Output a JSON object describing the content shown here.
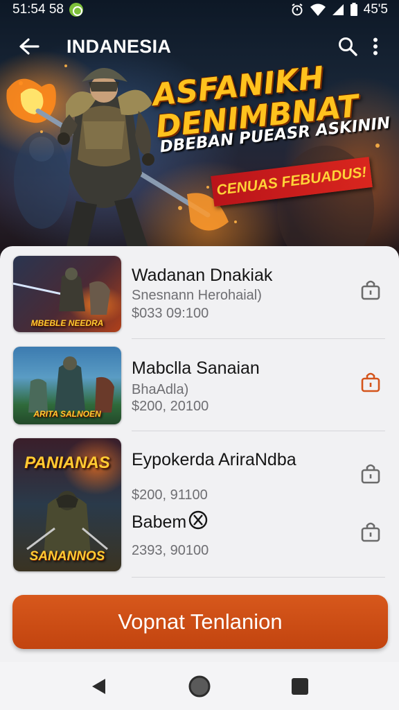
{
  "status_bar": {
    "time": "51:54 58",
    "battery": "45'5"
  },
  "app_bar": {
    "title": "INDANESIA",
    "icons": [
      "back-arrow-icon",
      "search-icon",
      "more-vert-icon"
    ]
  },
  "banner": {
    "title": "ASFANIKH DENIMBNAT",
    "subtitle": "DBEBAN PUEASR ASKININ",
    "ribbon": "CENUAS FEBUADUS!"
  },
  "items": [
    {
      "title": "Wadanan Dnakiak",
      "subtitle": "Snesnann Herohaial)",
      "price": "$033 09:100",
      "thumb_label": "MBEBLE NEEDRA",
      "lock_color": "#6b6b6b"
    },
    {
      "title": "Mabclla Sanaian",
      "subtitle": "BhaAdla)",
      "price": "$200, 20100",
      "thumb_label": "ARITA SALNOEN",
      "lock_color": "#d4541b"
    },
    {
      "title": "Eypokerda AriraNdba",
      "price": "$200, 91100",
      "thumb_label_top": "PANIANAS",
      "thumb_label_bottom": "SANANNOS",
      "lock_color": "#6b6b6b"
    },
    {
      "title": "Babem",
      "price": "2393, 90100",
      "lock_color": "#6b6b6b"
    }
  ],
  "cta": {
    "label": "Vopnat Tenlanion",
    "color": "#cc4e15"
  },
  "nav": {
    "icons": [
      "back-triangle-icon",
      "home-circle-icon",
      "recents-square-icon"
    ]
  }
}
